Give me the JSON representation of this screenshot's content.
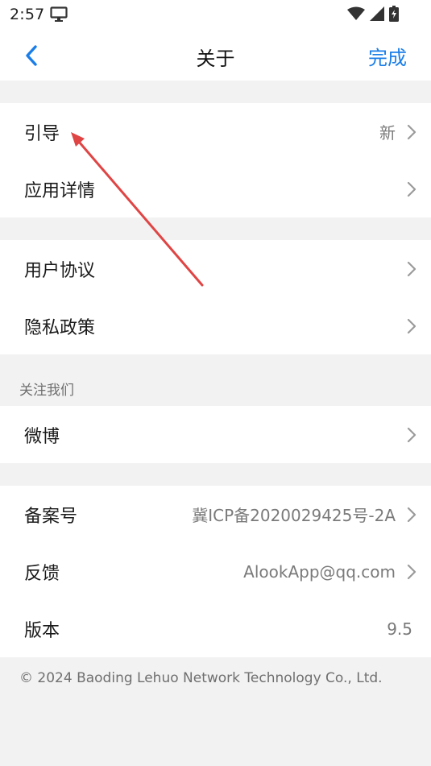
{
  "status": {
    "time": "2:57"
  },
  "nav": {
    "title": "关于",
    "done_label": "完成"
  },
  "group1": [
    {
      "label": "引导",
      "value": "新"
    },
    {
      "label": "应用详情",
      "value": ""
    }
  ],
  "group2": [
    {
      "label": "用户协议",
      "value": ""
    },
    {
      "label": "隐私政策",
      "value": ""
    }
  ],
  "follow": {
    "header": "关注我们",
    "items": [
      {
        "label": "微博",
        "value": ""
      }
    ]
  },
  "group4": [
    {
      "label": "备案号",
      "value": "冀ICP备2020029425号-2A"
    },
    {
      "label": "反馈",
      "value": "AlookApp@qq.com"
    },
    {
      "label": "版本",
      "value": "9.5"
    }
  ],
  "footer": "© 2024 Baoding Lehuo Network Technology Co., Ltd.",
  "colors": {
    "accent": "#1a7ee8",
    "annotation_arrow": "#e04545"
  }
}
